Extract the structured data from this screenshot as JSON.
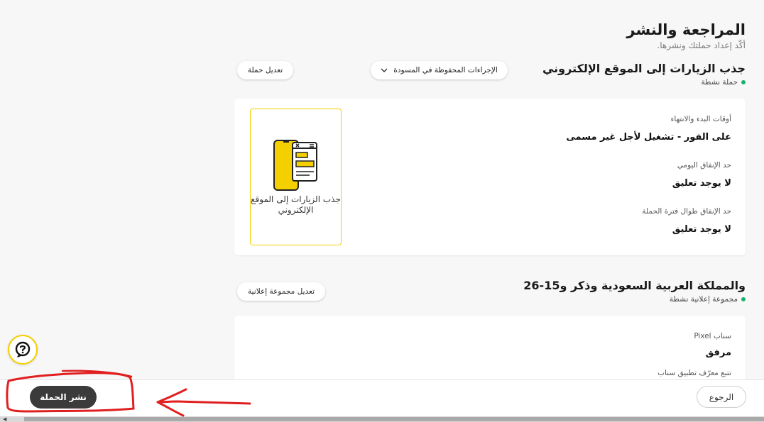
{
  "header": {
    "title": "المراجعة والنشر",
    "subtitle": "أكّد إعداد حملتك ونشرها."
  },
  "campaign": {
    "title": "جذب الزيارات إلى الموقع الإلكتروني",
    "status": "حملة نشطة",
    "edit_label": "تعديل حملة",
    "saved_actions_label": "الإجراءات المحفوظة في المسودة",
    "fields": [
      {
        "label": "أوقات البدء والانتهاء",
        "value": "على الفور - تشغيل لأجل غير مسمى"
      },
      {
        "label": "حد الإنفاق اليومي",
        "value": "لا يوجد تعليق"
      },
      {
        "label": "حد الإنفاق طوال فترة الحملة",
        "value": "لا يوجد تعليق"
      }
    ],
    "preview_caption": "جذب الزيارات إلى الموقع الإلكتروني"
  },
  "ad_group": {
    "title": "والمملكة العربية السعودية وذكر و15-26",
    "status": "مجموعة إعلانية نشطة",
    "edit_label": "تعديل مجموعة إعلانية",
    "fields": [
      {
        "label": "سناب Pixel",
        "value": "مرفق"
      },
      {
        "label": "تتبع معرّف تطبيق سناب",
        "value": ""
      }
    ]
  },
  "footer": {
    "back_label": "الرجوع",
    "publish_label": "نشر الحملة"
  },
  "icons": {
    "help": "help-question-icon",
    "chevron": "chevron-down-icon",
    "preview": "website-traffic-phone-icon",
    "scroll": "scroll-left-arrow-icon"
  },
  "colors": {
    "accent_yellow": "#F5D000",
    "status_green": "#17B26A",
    "publish_dark": "#3B3B3B",
    "annotation_red": "#E02020"
  }
}
